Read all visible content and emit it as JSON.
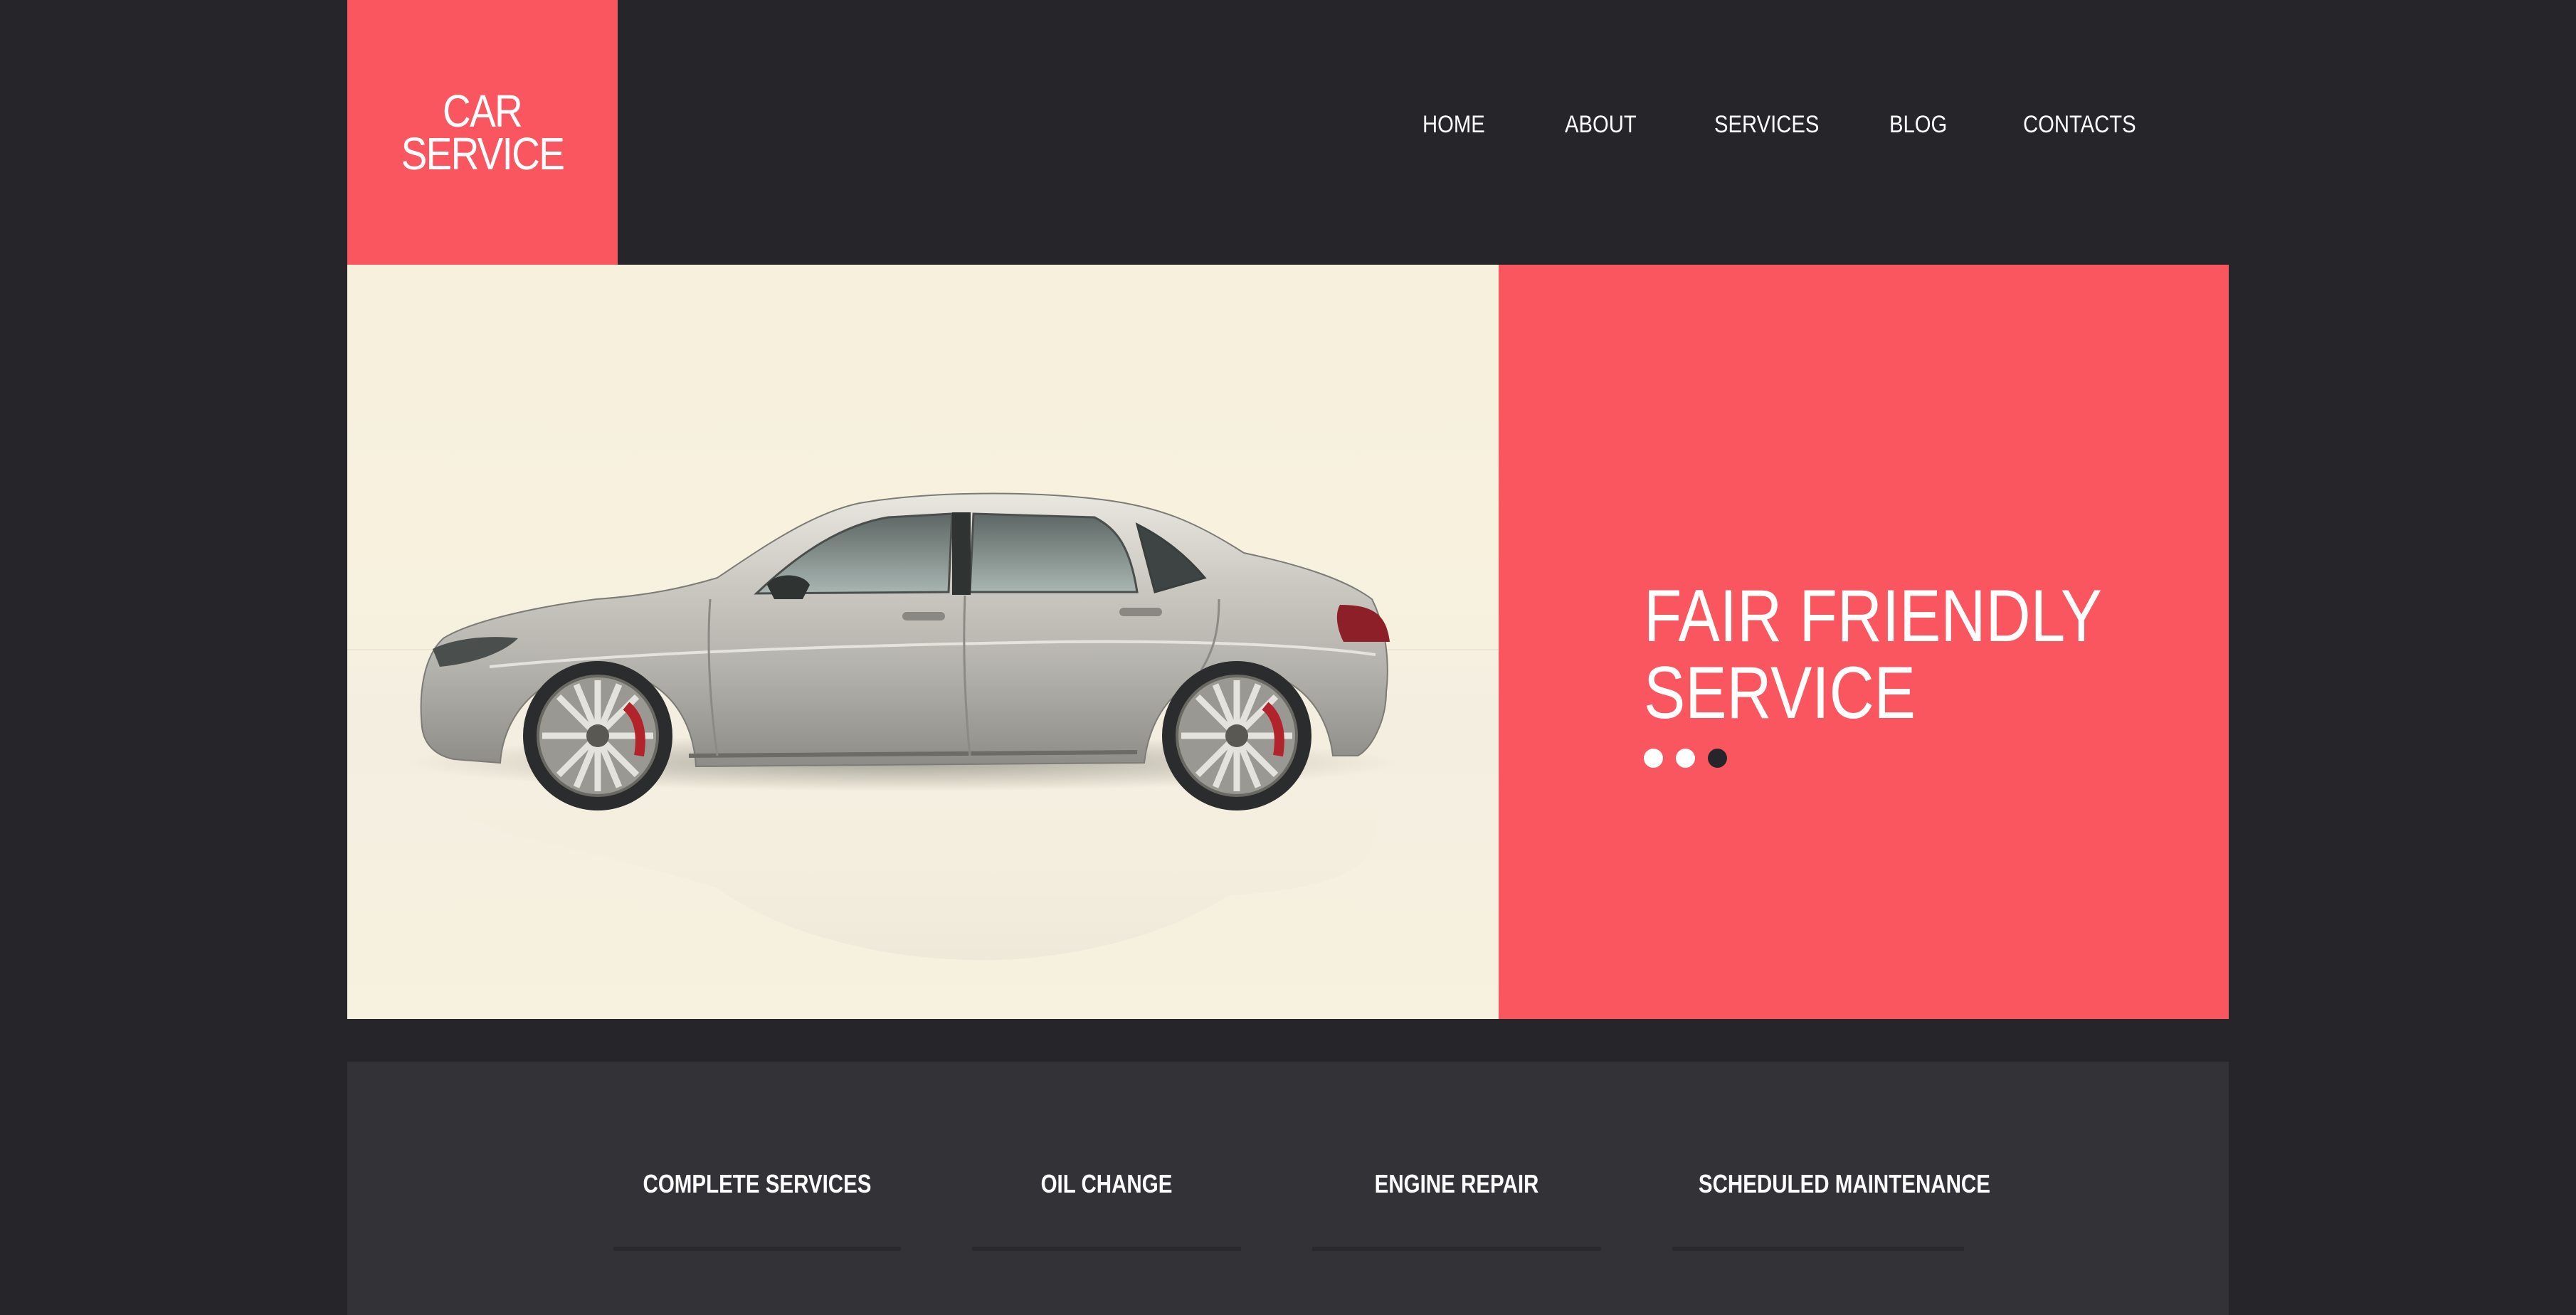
{
  "logo": {
    "line1": "CAR",
    "line2": "SERVICE"
  },
  "nav": {
    "items": [
      {
        "label": "HOME"
      },
      {
        "label": "ABOUT"
      },
      {
        "label": "SERVICES"
      },
      {
        "label": "BLOG"
      },
      {
        "label": "CONTACTS"
      }
    ]
  },
  "hero": {
    "title_line1": "FAIR FRIENDLY",
    "title_line2": "SERVICE",
    "slides_total": 3,
    "active_slide": 3,
    "image": "silver-sedan-photo"
  },
  "services": {
    "items": [
      {
        "title": "COMPLETE SERVICES"
      },
      {
        "title": "OIL CHANGE"
      },
      {
        "title": "ENGINE REPAIR"
      },
      {
        "title": "SCHEDULED MAINTENANCE"
      }
    ]
  },
  "colors": {
    "background": "#262529",
    "accent": "#fa5660",
    "services_bg": "#333237",
    "text": "#ffffff"
  }
}
